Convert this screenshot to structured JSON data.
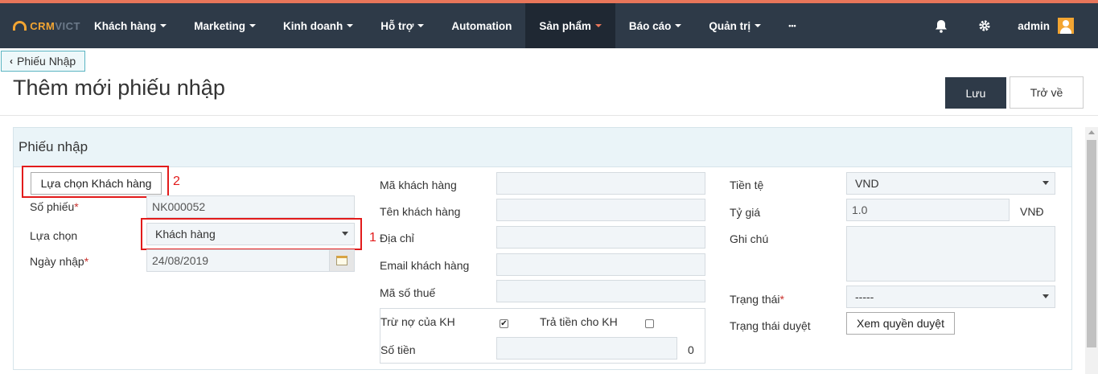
{
  "nav": {
    "logo_main": "CRM",
    "logo_sub": "VICT",
    "items": [
      {
        "label": "Khách hàng"
      },
      {
        "label": "Marketing"
      },
      {
        "label": "Kinh doanh"
      },
      {
        "label": "Hỗ trợ"
      },
      {
        "label": "Automation"
      },
      {
        "label": "Sản phẩm"
      },
      {
        "label": "Báo cáo"
      },
      {
        "label": "Quản trị"
      },
      {
        "label": "•••"
      }
    ],
    "user": "admin",
    "icons": [
      "bell-icon",
      "gear-icon",
      "user-avatar-icon"
    ],
    "accent_color": "#e8765a",
    "bar_color": "#2e3a48"
  },
  "breadcrumb": {
    "back_label": "Phiếu Nhập"
  },
  "page": {
    "title": "Thêm mới phiếu nhập",
    "save_label": "Lưu",
    "return_label": "Trở về"
  },
  "panel": {
    "title": "Phiếu nhập"
  },
  "form": {
    "choose_customer_label": "Lựa chọn Khách hàng",
    "anno_2": "2",
    "anno_1": "1",
    "so_phieu_label": "Số phiếu",
    "so_phieu_value": "NK000052",
    "lua_chon_label": "Lựa chọn",
    "lua_chon_value": "Khách hàng",
    "ngay_nhap_label": "Ngày nhập",
    "ngay_nhap_value": "24/08/2019",
    "required_mark": "*",
    "ma_kh_label": "Mã khách hàng",
    "ten_kh_label": "Tên khách hàng",
    "dia_chi_label": "Địa chỉ",
    "email_label": "Email khách hàng",
    "mst_label": "Mã số thuế",
    "tru_no_label": "Trừ nợ của KH",
    "tru_no_checked": true,
    "tra_tien_label": "Trả tiền cho KH",
    "tra_tien_checked": false,
    "so_tien_label": "Số tiền",
    "so_tien_value": "0",
    "tien_te_label": "Tiền tệ",
    "tien_te_value": "VND",
    "ty_gia_label": "Tỷ giá",
    "ty_gia_value": "1.0",
    "ty_gia_unit": "VNĐ",
    "ghi_chu_label": "Ghi chú",
    "trang_thai_label": "Trạng thái",
    "trang_thai_value": "-----",
    "trang_thai_duyet_label": "Trạng thái duyệt",
    "xem_quyen_duyet_label": "Xem quyền duyệt",
    "check_mark": "✔"
  }
}
